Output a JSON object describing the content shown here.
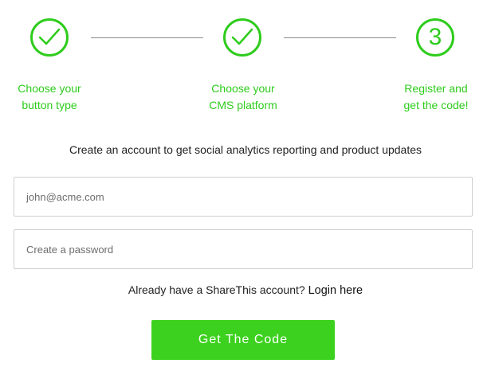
{
  "colors": {
    "accent": "#2ecc1c",
    "button": "#3cd11e",
    "connector": "#8a8a8a",
    "field_border": "#cfcfcf"
  },
  "steps": [
    {
      "status": "complete",
      "icon": "checkmark-icon",
      "label_line1": "Choose your",
      "label_line2": "button type"
    },
    {
      "status": "complete",
      "icon": "checkmark-icon",
      "label_line1": "Choose your",
      "label_line2": "CMS platform"
    },
    {
      "status": "current",
      "number": "3",
      "label_line1": "Register and",
      "label_line2": "get the code!"
    }
  ],
  "form": {
    "tagline": "Create an account to get social analytics reporting and product updates",
    "email_placeholder": "john@acme.com",
    "email_value": "",
    "password_placeholder": "Create a password",
    "password_value": "",
    "login_prompt": "Already have a ShareThis account?",
    "login_link": "Login here",
    "submit_label": "Get The Code"
  }
}
